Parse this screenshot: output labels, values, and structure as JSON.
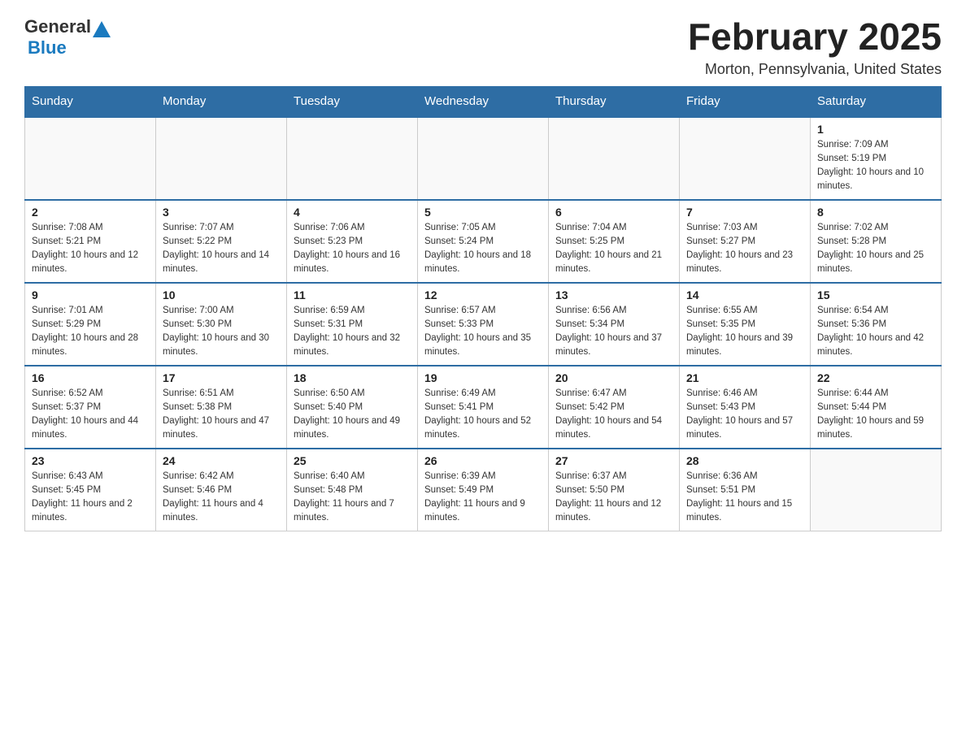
{
  "header": {
    "logo_general": "General",
    "logo_blue": "Blue",
    "month_title": "February 2025",
    "location": "Morton, Pennsylvania, United States"
  },
  "weekdays": [
    "Sunday",
    "Monday",
    "Tuesday",
    "Wednesday",
    "Thursday",
    "Friday",
    "Saturday"
  ],
  "weeks": [
    [
      {
        "day": "",
        "info": ""
      },
      {
        "day": "",
        "info": ""
      },
      {
        "day": "",
        "info": ""
      },
      {
        "day": "",
        "info": ""
      },
      {
        "day": "",
        "info": ""
      },
      {
        "day": "",
        "info": ""
      },
      {
        "day": "1",
        "info": "Sunrise: 7:09 AM\nSunset: 5:19 PM\nDaylight: 10 hours and 10 minutes."
      }
    ],
    [
      {
        "day": "2",
        "info": "Sunrise: 7:08 AM\nSunset: 5:21 PM\nDaylight: 10 hours and 12 minutes."
      },
      {
        "day": "3",
        "info": "Sunrise: 7:07 AM\nSunset: 5:22 PM\nDaylight: 10 hours and 14 minutes."
      },
      {
        "day": "4",
        "info": "Sunrise: 7:06 AM\nSunset: 5:23 PM\nDaylight: 10 hours and 16 minutes."
      },
      {
        "day": "5",
        "info": "Sunrise: 7:05 AM\nSunset: 5:24 PM\nDaylight: 10 hours and 18 minutes."
      },
      {
        "day": "6",
        "info": "Sunrise: 7:04 AM\nSunset: 5:25 PM\nDaylight: 10 hours and 21 minutes."
      },
      {
        "day": "7",
        "info": "Sunrise: 7:03 AM\nSunset: 5:27 PM\nDaylight: 10 hours and 23 minutes."
      },
      {
        "day": "8",
        "info": "Sunrise: 7:02 AM\nSunset: 5:28 PM\nDaylight: 10 hours and 25 minutes."
      }
    ],
    [
      {
        "day": "9",
        "info": "Sunrise: 7:01 AM\nSunset: 5:29 PM\nDaylight: 10 hours and 28 minutes."
      },
      {
        "day": "10",
        "info": "Sunrise: 7:00 AM\nSunset: 5:30 PM\nDaylight: 10 hours and 30 minutes."
      },
      {
        "day": "11",
        "info": "Sunrise: 6:59 AM\nSunset: 5:31 PM\nDaylight: 10 hours and 32 minutes."
      },
      {
        "day": "12",
        "info": "Sunrise: 6:57 AM\nSunset: 5:33 PM\nDaylight: 10 hours and 35 minutes."
      },
      {
        "day": "13",
        "info": "Sunrise: 6:56 AM\nSunset: 5:34 PM\nDaylight: 10 hours and 37 minutes."
      },
      {
        "day": "14",
        "info": "Sunrise: 6:55 AM\nSunset: 5:35 PM\nDaylight: 10 hours and 39 minutes."
      },
      {
        "day": "15",
        "info": "Sunrise: 6:54 AM\nSunset: 5:36 PM\nDaylight: 10 hours and 42 minutes."
      }
    ],
    [
      {
        "day": "16",
        "info": "Sunrise: 6:52 AM\nSunset: 5:37 PM\nDaylight: 10 hours and 44 minutes."
      },
      {
        "day": "17",
        "info": "Sunrise: 6:51 AM\nSunset: 5:38 PM\nDaylight: 10 hours and 47 minutes."
      },
      {
        "day": "18",
        "info": "Sunrise: 6:50 AM\nSunset: 5:40 PM\nDaylight: 10 hours and 49 minutes."
      },
      {
        "day": "19",
        "info": "Sunrise: 6:49 AM\nSunset: 5:41 PM\nDaylight: 10 hours and 52 minutes."
      },
      {
        "day": "20",
        "info": "Sunrise: 6:47 AM\nSunset: 5:42 PM\nDaylight: 10 hours and 54 minutes."
      },
      {
        "day": "21",
        "info": "Sunrise: 6:46 AM\nSunset: 5:43 PM\nDaylight: 10 hours and 57 minutes."
      },
      {
        "day": "22",
        "info": "Sunrise: 6:44 AM\nSunset: 5:44 PM\nDaylight: 10 hours and 59 minutes."
      }
    ],
    [
      {
        "day": "23",
        "info": "Sunrise: 6:43 AM\nSunset: 5:45 PM\nDaylight: 11 hours and 2 minutes."
      },
      {
        "day": "24",
        "info": "Sunrise: 6:42 AM\nSunset: 5:46 PM\nDaylight: 11 hours and 4 minutes."
      },
      {
        "day": "25",
        "info": "Sunrise: 6:40 AM\nSunset: 5:48 PM\nDaylight: 11 hours and 7 minutes."
      },
      {
        "day": "26",
        "info": "Sunrise: 6:39 AM\nSunset: 5:49 PM\nDaylight: 11 hours and 9 minutes."
      },
      {
        "day": "27",
        "info": "Sunrise: 6:37 AM\nSunset: 5:50 PM\nDaylight: 11 hours and 12 minutes."
      },
      {
        "day": "28",
        "info": "Sunrise: 6:36 AM\nSunset: 5:51 PM\nDaylight: 11 hours and 15 minutes."
      },
      {
        "day": "",
        "info": ""
      }
    ]
  ]
}
